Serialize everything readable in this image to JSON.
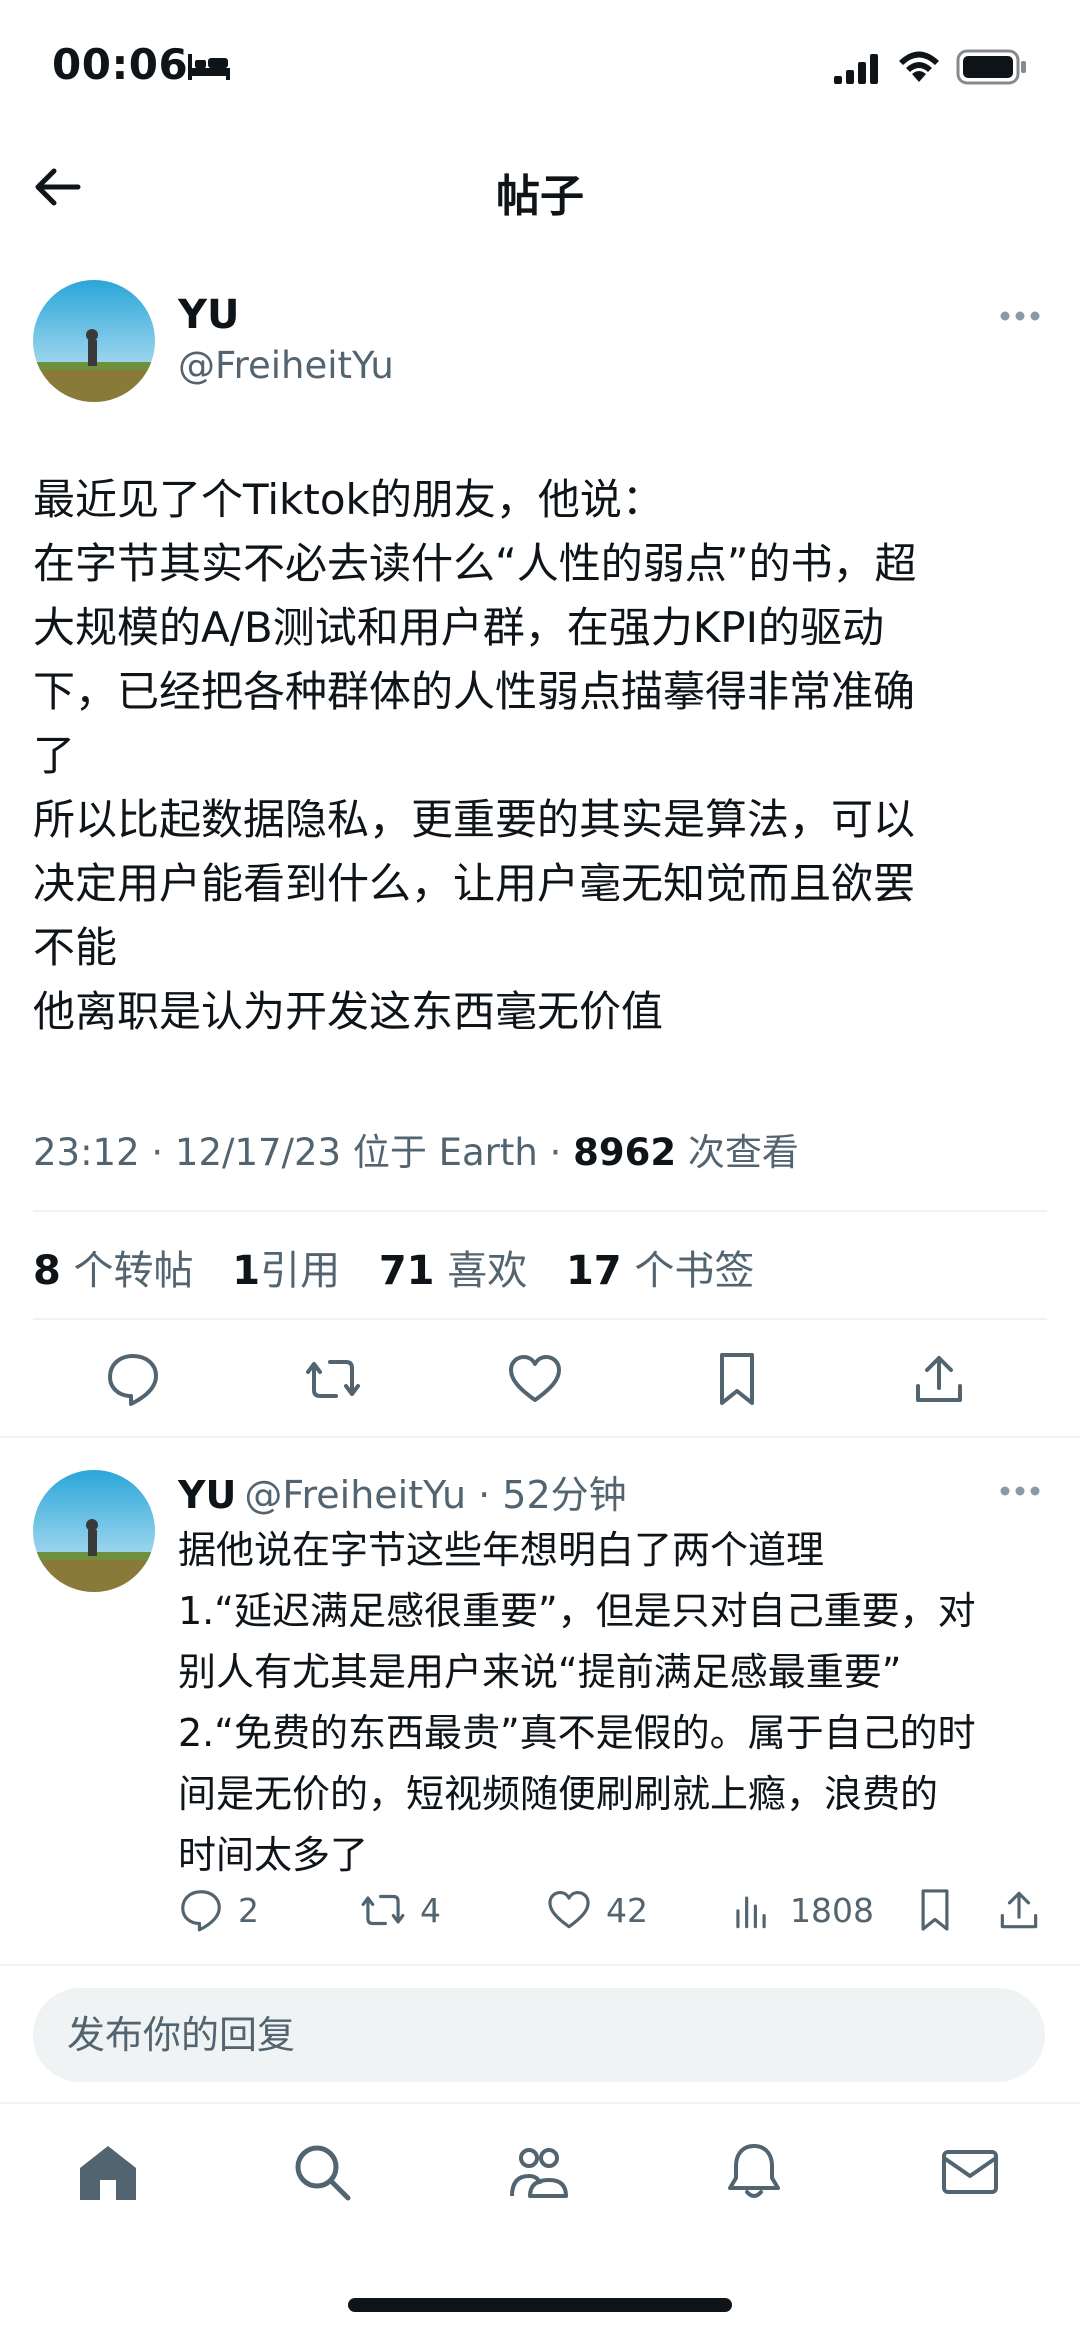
{
  "status_bar": {
    "time": "00:06"
  },
  "header": {
    "title": "帖子"
  },
  "post": {
    "author_name": "YU",
    "author_handle": "@FreiheitYu",
    "text_lines": [
      "最近见了个Tiktok的朋友，他说：",
      "在字节其实不必去读什么“人性的弱点”的书，超",
      "大规模的A/B测试和用户群，在强力KPI的驱动",
      "下，已经把各种群体的人性弱点描摹得非常准确",
      "了",
      "所以比起数据隐私，更重要的其实是算法，可以",
      "决定用户能看到什么，让用户毫无知觉而且欲罢",
      "不能",
      "他离职是认为开发这东西毫无价值"
    ],
    "meta_time": "23:12 · 12/17/23 位于 Earth · ",
    "meta_views": "8962",
    "meta_views_label": " 次查看",
    "stats": {
      "reposts_count": "8",
      "reposts_label": " 个转帖",
      "quotes_count": "1",
      "quotes_label": "引用",
      "likes_count": "71",
      "likes_label": " 喜欢",
      "bookmarks_count": "17",
      "bookmarks_label": " 个书签"
    }
  },
  "reply": {
    "author_name": "YU",
    "author_handle": "@FreiheitYu",
    "time": " · 52分钟",
    "text_lines": [
      "据他说在字节这些年想明白了两个道理",
      "1.“延迟满足感很重要”，但是只对自己重要，对",
      "别人有尤其是用户来说“提前满足感最重要”",
      "2.“免费的东西最贵”真不是假的。属于自己的时",
      "间是无价的，短视频随便刷刷就上瘾，浪费的",
      "时间太多了"
    ],
    "replies": "2",
    "reposts": "4",
    "likes": "42",
    "views": "1808"
  },
  "composer": {
    "placeholder": "发布你的回复"
  },
  "icons": {
    "status": [
      "bed-icon",
      "signal-icon",
      "wifi-icon",
      "battery-icon"
    ],
    "actions": [
      "reply-icon",
      "repost-icon",
      "like-icon",
      "bookmark-icon",
      "share-icon",
      "views-icon"
    ],
    "tabs": [
      "home-icon",
      "search-icon",
      "communities-icon",
      "notifications-icon",
      "messages-icon"
    ]
  },
  "colors": {
    "text": "#0f1419",
    "secondary": "#536471",
    "divider": "#eff3f4"
  }
}
